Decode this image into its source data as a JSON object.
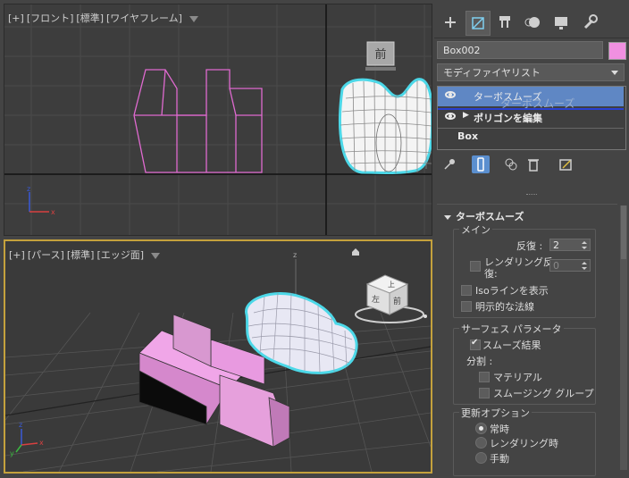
{
  "viewport_front": {
    "label_plus": "[+]",
    "label_view": "[フロント]",
    "label_shading": "[標準]",
    "label_mode": "[ワイヤフレーム]",
    "viewcube_label": "前"
  },
  "viewport_persp": {
    "label_plus": "[+]",
    "label_view": "[パース]",
    "label_shading": "[標準]",
    "label_mode": "[エッジ面]",
    "cube_top": "上",
    "cube_left": "左",
    "cube_front": "前"
  },
  "axis": {
    "x": "x",
    "y": "y",
    "z": "z"
  },
  "panel": {
    "tabs": [
      "create",
      "modify",
      "hierarchy",
      "motion",
      "display",
      "utilities"
    ],
    "object_name": "Box002",
    "object_color": "#f090e0",
    "modifier_list": "モディファイヤリスト",
    "stack": {
      "item1": "ターボスムーズ",
      "item1_ghost": "ターボスムーズ",
      "item2": "ポリゴンを編集",
      "item3": "Box"
    },
    "rollout_title": "ターボスムーズ",
    "main_group": "メイン",
    "iterations_label": "反復 :",
    "iterations_value": "2",
    "render_iter_label_1": "レンダリング反",
    "render_iter_label_2": "復:",
    "render_iter_value": "0",
    "iso_label": "Isoラインを表示",
    "explicit_normals_label": "明示的な法線",
    "surface_group": "サーフェス パラメータ",
    "smooth_result_label": "スムーズ結果",
    "separate_label": "分割 :",
    "material_label": "マテリアル",
    "smoothing_group_label": "スムージング グループ",
    "update_group": "更新オプション",
    "always_label": "常時",
    "when_rendering_label": "レンダリング時",
    "manual_label": "手動"
  }
}
